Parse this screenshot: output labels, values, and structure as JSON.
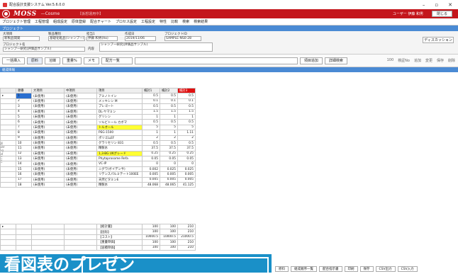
{
  "window": {
    "title": "配合設計支援システム Ver.5.6.0.0",
    "min": "–",
    "max": "▫",
    "close": "✕"
  },
  "banner": {
    "logo": "MOSS",
    "subtitle": "—Cosme",
    "subtitle2": "【仮想運用中】",
    "user": "ユーザー 伊藤 和男",
    "close_label": "閉じる"
  },
  "menu": [
    "プロジェクト管理",
    "工程管理",
    "組成設定",
    "原体登録",
    "配合チャート",
    "プロセス設定",
    "工程設定",
    "特性",
    "比較",
    "検索",
    "検索結果"
  ],
  "project": {
    "header": "プロジェクト",
    "fields": [
      {
        "label": "大項目",
        "value": "新製品開発"
      },
      {
        "label": "製品種別",
        "value": "基礎化粧品(シャンプー)"
      },
      {
        "label": "担当1",
        "value": "伊藤 和男(Ito)"
      },
      {
        "label": "作成日",
        "value": "2019/11/06"
      },
      {
        "label": "プロジェクトID",
        "value": "SAMPLE-NS0-28"
      }
    ],
    "name_label": "プロジェクト名",
    "name_value": "シャンプー研究(評価品サンプル)",
    "content_label": "内容",
    "content_value": "シャンプー研究(評価品サンプル)",
    "discussion_button": "ディスカッション"
  },
  "toolbar": {
    "buttons": [
      "一括挿入",
      "原料",
      "溶媒",
      "重量%",
      "メモ"
    ],
    "select_value": "配方一覧",
    "right_buttons": [
      "項目追加",
      "詳細検索"
    ],
    "links": [
      "100",
      "検証No",
      "追加",
      "変更",
      "保存",
      "削除"
    ]
  },
  "grid": {
    "header": "組成情報",
    "columns": [
      "順番",
      "大項目",
      "中項目",
      "項目",
      "検討1",
      "検討2",
      "検討3"
    ],
    "rows": [
      {
        "no": "1",
        "major": "(未使用)",
        "mid": "(未使用)",
        "item": "アミノトイン",
        "v1": "0.5",
        "v2": "0.5",
        "v3": "0.5",
        "hl": false
      },
      {
        "no": "2",
        "major": "(未使用)",
        "mid": "(未使用)",
        "item": "メッキシン M",
        "v1": "0.1",
        "v2": "0.1",
        "v3": "0.1",
        "hl": false
      },
      {
        "no": "3",
        "major": "(未使用)",
        "mid": "(未使用)",
        "item": "プレゴート",
        "v1": "0.5",
        "v2": "0.5",
        "v3": "0.5",
        "hl": false
      },
      {
        "no": "4",
        "major": "(未使用)",
        "mid": "(未使用)",
        "item": "DL-ヤマミン",
        "v1": "1.5",
        "v2": "1.5",
        "v3": "1.5",
        "hl": false
      },
      {
        "no": "5",
        "major": "(未使用)",
        "mid": "(未使用)",
        "item": "グリシン",
        "v1": "1",
        "v2": "1",
        "v3": "1",
        "hl": false
      },
      {
        "no": "6",
        "major": "(未使用)",
        "mid": "(未使用)",
        "item": "ソルビトール カボマ",
        "v1": "0.5",
        "v2": "0.5",
        "v3": "0.5",
        "hl": false
      },
      {
        "no": "7",
        "major": "(未使用)",
        "mid": "(未使用)",
        "item": "トルオール",
        "v1": "5",
        "v2": "5",
        "v3": "5",
        "hl": true
      },
      {
        "no": "8",
        "major": "(未使用)",
        "mid": "(未使用)",
        "item": "PEG-1500",
        "v1": "1",
        "v2": "1",
        "v3": "1.11",
        "hl": false
      },
      {
        "no": "9",
        "major": "(未使用)",
        "mid": "(未使用)",
        "item": "ポリゴムEF",
        "v1": "2",
        "v2": "2",
        "v3": "2",
        "hl": false
      },
      {
        "no": "10",
        "major": "(未使用)",
        "mid": "(未使用)",
        "item": "グラリセリン 831",
        "v1": "0.5",
        "v2": "0.5",
        "v3": "0.5",
        "hl": false
      },
      {
        "no": "11",
        "major": "(未使用)",
        "mid": "(未使用)",
        "item": "精製水",
        "v1": "37.5",
        "v2": "37.5",
        "v3": "37.5",
        "hl": false
      },
      {
        "no": "12",
        "major": "(未使用)",
        "mid": "(未使用)",
        "item": "1,3-BG UKグレード",
        "v1": "0.25",
        "v2": "0.25",
        "v3": "0.25",
        "hl": true
      },
      {
        "no": "13",
        "major": "(未使用)",
        "mid": "(未使用)",
        "item": "Phytaprosome Refa",
        "v1": "0.05",
        "v2": "0.05",
        "v3": "0.05",
        "hl": false
      },
      {
        "no": "14",
        "major": "(未使用)",
        "mid": "(未使用)",
        "item": "VC-IP",
        "v1": "0",
        "v2": "0",
        "v3": "0",
        "hl": false
      },
      {
        "no": "15",
        "major": "(未使用)",
        "mid": "(未使用)",
        "item": "ニグワ(ボイデンサ)",
        "v1": "0.002",
        "v2": "0.025",
        "v3": "0.025",
        "hl": false
      },
      {
        "no": "16",
        "major": "(未使用)",
        "mid": "(未使用)",
        "item": "リテンスパルミテート100EE",
        "v1": "0.005",
        "v2": "0.005",
        "v3": "0.005",
        "hl": false
      },
      {
        "no": "17",
        "major": "(未使用)",
        "mid": "(未使用)",
        "item": "天然ビタミンE",
        "v1": "0.005",
        "v2": "0.005",
        "v3": "0.005",
        "hl": false
      },
      {
        "no": "18",
        "major": "(未使用)",
        "mid": "(未使用)",
        "item": "精製水",
        "v1": "48.068",
        "v2": "48.065",
        "v3": "41.125",
        "hl": false
      }
    ]
  },
  "summary": {
    "rows": [
      {
        "item": "【総計量】",
        "v1": "100",
        "v2": "100",
        "v3": "210"
      },
      {
        "item": "【固形】",
        "v1": "100",
        "v2": "100",
        "v3": "210"
      },
      {
        "item": "【コスト】",
        "v1": "10000.5",
        "v2": "10000.5",
        "v3": "21000.5"
      },
      {
        "item": "【重量単価】",
        "v1": "100",
        "v2": "100",
        "v3": "210"
      },
      {
        "item": "【容積単価】",
        "v1": "100",
        "v2": "100",
        "v3": "210"
      }
    ]
  },
  "bottom_buttons": [
    "原料",
    "組成順序一覧",
    "配合指示書",
    "印刷",
    "保存",
    "CSV出力",
    "CSV入力"
  ],
  "side_labels": [
    "訳",
    "ver",
    "ng",
    "ut",
    "ご",
    "こ"
  ],
  "overlay_text": "看図表のプレゼン"
}
